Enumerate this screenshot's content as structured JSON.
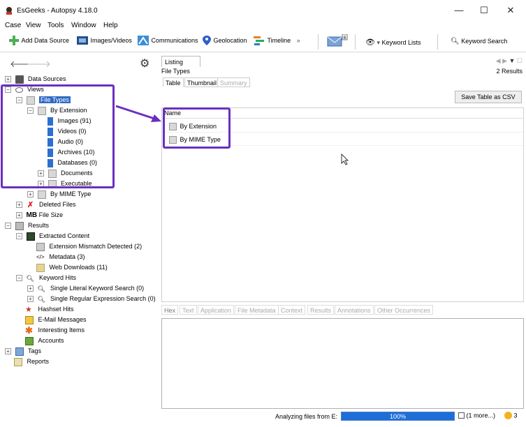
{
  "window": {
    "title": "EsGeeks - Autopsy 4.18.0",
    "controls": {
      "minimize": "—",
      "maximize": "☐",
      "close": "✕"
    }
  },
  "menu": [
    "Case",
    "View",
    "Tools",
    "Window",
    "Help"
  ],
  "toolbar": {
    "add_data_source": "Add Data Source",
    "images_videos": "Images/Videos",
    "communications": "Communications",
    "geolocation": "Geolocation",
    "timeline": "Timeline",
    "keyword_lists": "Keyword Lists",
    "keyword_search": "Keyword Search",
    "mail_badge": "6"
  },
  "tree": {
    "data_sources": "Data Sources",
    "views": "Views",
    "file_types": "File Types",
    "by_extension": "By Extension",
    "images": "Images (91)",
    "videos": "Videos (0)",
    "audio": "Audio (0)",
    "archives": "Archives (10)",
    "databases": "Databases (0)",
    "documents": "Documents",
    "executable": "Executable",
    "by_mime_type": "By MIME Type",
    "deleted_files": "Deleted Files",
    "file_size": "File Size",
    "file_size_prefix": "MB",
    "results": "Results",
    "extracted_content": "Extracted Content",
    "extension_mismatch": "Extension Mismatch Detected (2)",
    "metadata": "Metadata (3)",
    "web_downloads": "Web Downloads (11)",
    "keyword_hits": "Keyword Hits",
    "single_literal": "Single Literal Keyword Search (0)",
    "single_regex": "Single Regular Expression Search (0)",
    "hashset_hits": "Hashset Hits",
    "email_messages": "E-Mail Messages",
    "interesting_items": "Interesting Items",
    "accounts": "Accounts",
    "tags": "Tags",
    "reports": "Reports"
  },
  "listing": {
    "tab": "Listing",
    "path_label": "File Types",
    "results_count": "2  Results",
    "subtabs": [
      "Table",
      "Thumbnail",
      "Summary"
    ],
    "save_csv": "Save Table as CSV",
    "column_name": "Name",
    "rows": [
      "By Extension",
      "By MIME Type"
    ]
  },
  "content_tabs": [
    "Hex",
    "Text",
    "Application",
    "File Metadata",
    "Context",
    "Results",
    "Annotations",
    "Other Occurrences"
  ],
  "status": {
    "analyzing": "Analyzing files from E:",
    "progress": "100%",
    "progress_value": 100,
    "more": "(1 more...)",
    "notifications": "3"
  },
  "colors": {
    "highlight": "#6a2fc0",
    "selection": "#2f6ac4",
    "progress": "#1e6ed8"
  }
}
